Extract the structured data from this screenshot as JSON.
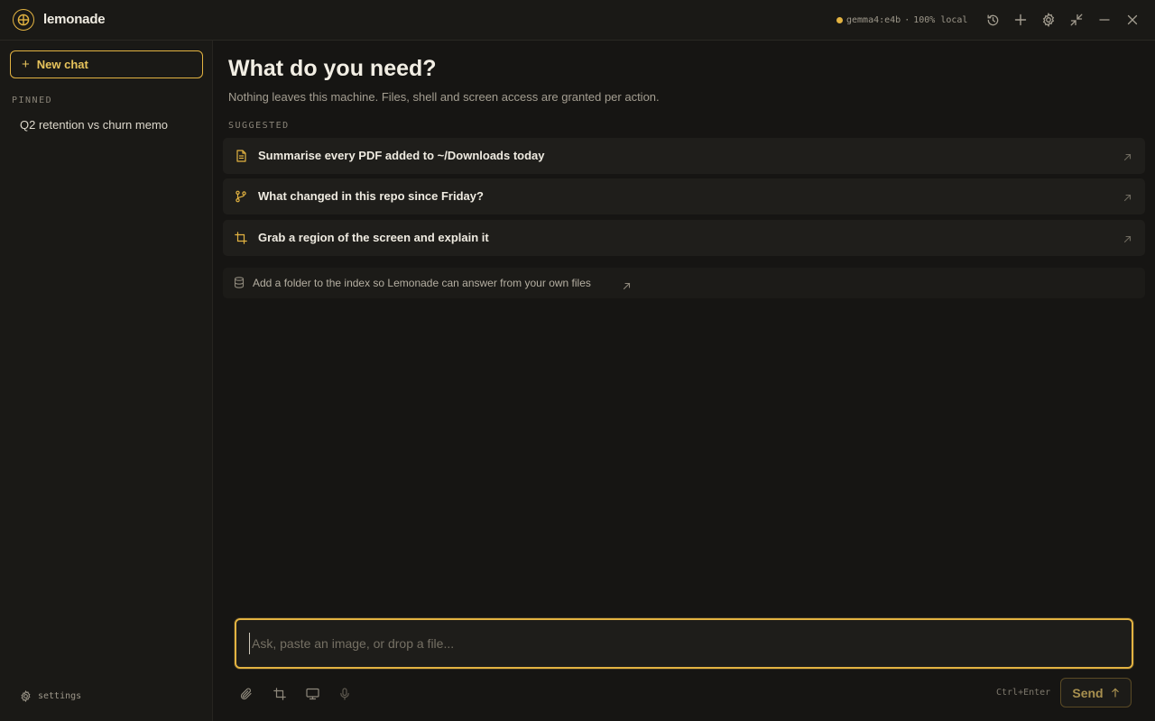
{
  "app": {
    "title": "lemonade",
    "model_label": "gemma4:e4b",
    "separator": "·",
    "locality": "100% local",
    "accent": "#e3b341",
    "background": "#161513"
  },
  "titlebar_icons": [
    "history-icon",
    "plus-icon",
    "gear-icon",
    "collapse-icon",
    "minimize-icon",
    "close-icon"
  ],
  "sidebar": {
    "new_chat_label": "New chat",
    "pinned_label": "PINNED",
    "pinned_items": [
      {
        "label": "Q2 retention vs churn memo"
      }
    ],
    "settings_label": "settings"
  },
  "main": {
    "title": "What do you need?",
    "subtitle": "Nothing leaves this machine. Files, shell and screen access are granted per action.",
    "suggested_label": "SUGGESTED",
    "suggestions": [
      {
        "icon": "document-icon",
        "label": "Summarise every PDF added to ~/Downloads today"
      },
      {
        "icon": "git-branch-icon",
        "label": "What changed in this repo since Friday?"
      },
      {
        "icon": "crop-icon",
        "label": "Grab a region of the screen and explain it"
      }
    ],
    "index_prompt": {
      "icon": "database-icon",
      "label": "Add a folder to the index so Lemonade can answer from your own files"
    }
  },
  "composer": {
    "placeholder": "Ask, paste an image, or drop a file...",
    "value": "",
    "tools": [
      "paperclip-icon",
      "crop-icon",
      "monitor-icon",
      "microphone-icon"
    ],
    "shortcut": "Ctrl+Enter",
    "send_label": "Send"
  }
}
